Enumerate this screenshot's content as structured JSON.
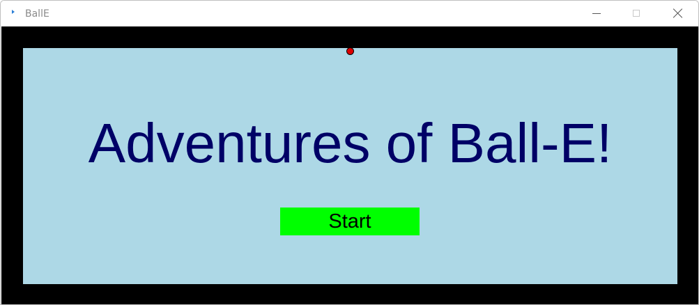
{
  "window": {
    "title": "BallE"
  },
  "game": {
    "headline": "Adventures of Ball-E!",
    "start_label": "Start",
    "colors": {
      "frame": "#000000",
      "field": "#add8e6",
      "headline": "#000066",
      "start_button": "#00ff00",
      "ball": "#dd0000"
    }
  }
}
